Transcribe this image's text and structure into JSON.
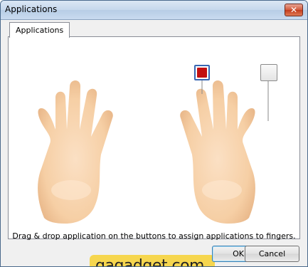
{
  "window": {
    "title": "Applications"
  },
  "tabs": [
    {
      "label": "Applications"
    }
  ],
  "hint": "Drag & drop application on the buttons to assign applications to fingers.",
  "buttons": {
    "ok": "OK",
    "cancel": "Cancel"
  },
  "slots": [
    {
      "icon": "pdf-icon",
      "state": "assigned"
    },
    {
      "icon": "",
      "state": "empty"
    }
  ],
  "watermark": "gagadget.com",
  "colors": {
    "skin": "#f8d4b0",
    "accent": "#3867b2",
    "pdf": "#c31010",
    "watermark_bg": "#f6d64e"
  }
}
